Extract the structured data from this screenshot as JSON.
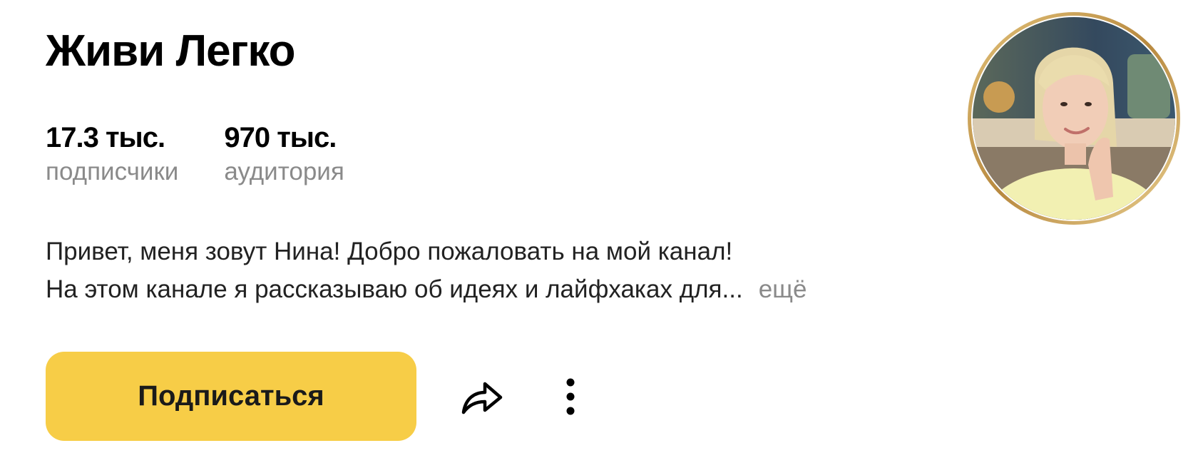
{
  "channel": {
    "name": "Живи Легко"
  },
  "stats": [
    {
      "value": "17.3 тыс.",
      "label": "подписчики"
    },
    {
      "value": "970 тыс.",
      "label": "аудитория"
    }
  ],
  "description": {
    "line1": "Привет, меня зовут Нина! Добро пожаловать на мой канал!",
    "line2": "На этом канале я рассказываю об идеях и лайфхаках для...",
    "more_label": "ещё"
  },
  "actions": {
    "subscribe_label": "Подписаться",
    "share_icon": "share-icon",
    "more_icon": "more-vertical-icon"
  },
  "colors": {
    "accent": "#f7cd47",
    "muted_text": "#8a8a8a",
    "avatar_ring": "#c9a45a"
  }
}
